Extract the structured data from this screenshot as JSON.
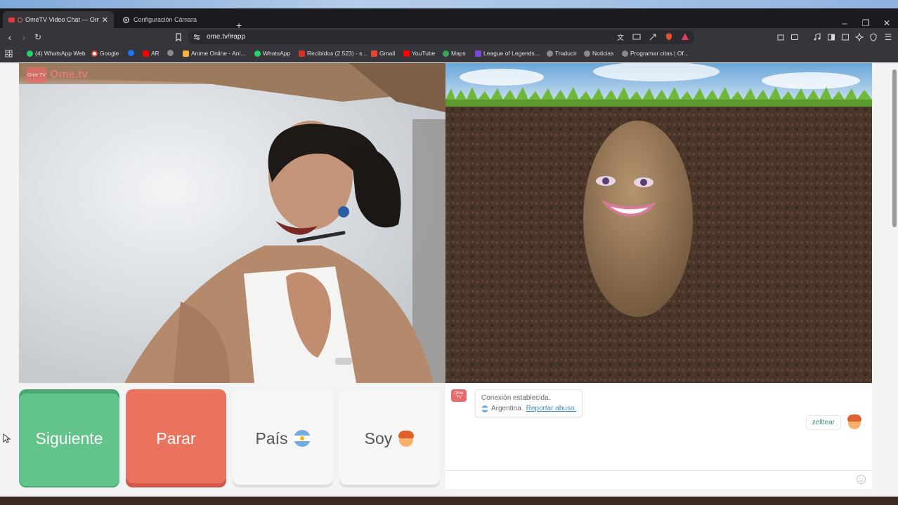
{
  "browser": {
    "tabs": [
      {
        "title": "OmeTV Video Chat — Omeg",
        "active": true
      },
      {
        "title": "Configuración Cámara",
        "active": false
      }
    ],
    "url": "ome.tv/#app",
    "bookmarks": [
      {
        "label": "(4) WhatsApp Web",
        "color": "#25d366"
      },
      {
        "label": "Google",
        "color": "#ffffff"
      },
      {
        "label": "",
        "color": "#1877f2"
      },
      {
        "label": "AR",
        "color": "#ff0000"
      },
      {
        "label": "",
        "color": "#9e9e9e"
      },
      {
        "label": "Anime Online - Ani...",
        "color": "#f5b342"
      },
      {
        "label": "WhatsApp",
        "color": "#25d366"
      },
      {
        "label": "Recibidos (2.523) - s...",
        "color": "#d93025"
      },
      {
        "label": "Gmail",
        "color": "#ea4335"
      },
      {
        "label": "YouTube",
        "color": "#ff0000"
      },
      {
        "label": "Maps",
        "color": "#34a853"
      },
      {
        "label": "League of Legends...",
        "color": "#7b4ad8"
      },
      {
        "label": "Traducir",
        "color": "#9e9e9e"
      },
      {
        "label": "Noticias",
        "color": "#9e9e9e"
      },
      {
        "label": "Programar citas | Of...",
        "color": "#9e9e9e"
      }
    ]
  },
  "app": {
    "logo": "Ome.tv",
    "logo_icon": "Ome TV",
    "buttons": {
      "next": "Siguiente",
      "stop": "Parar",
      "country": "País",
      "country_flag": "🇦🇷",
      "gender": "Soy",
      "gender_emoji": "🧑"
    },
    "chat": {
      "system_line1": "Conexión establecida.",
      "country": "Argentina.",
      "report_link": "Reportar abuso.",
      "username": "zelltear",
      "user_emoji": "🧑"
    }
  },
  "colors": {
    "next": "#62c48a",
    "stop": "#ea735f",
    "accent": "#3d8cc7"
  }
}
